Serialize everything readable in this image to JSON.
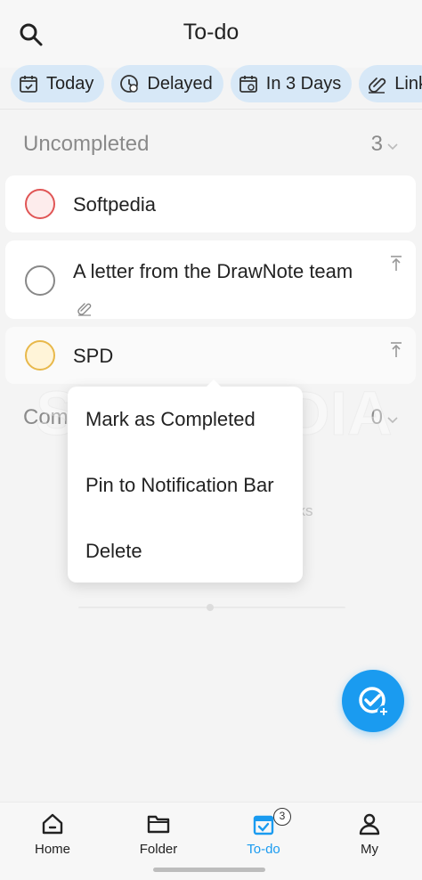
{
  "header": {
    "title": "To-do"
  },
  "chips": [
    {
      "label": "Today",
      "icon": "calendar-check-icon"
    },
    {
      "label": "Delayed",
      "icon": "clock-alert-icon"
    },
    {
      "label": "In 3 Days",
      "icon": "calendar-icon"
    },
    {
      "label": "Link",
      "icon": "link-icon"
    }
  ],
  "uncompleted": {
    "label": "Uncompleted",
    "count": "3"
  },
  "tasks": [
    {
      "title": "Softpedia",
      "circle_color": "#e05555",
      "circle_fill": "#fdecec"
    },
    {
      "title": "A letter from the DrawNote team",
      "circle_color": "#8a8a8a",
      "circle_fill": "#ffffff"
    },
    {
      "title": "SPD",
      "circle_color": "#e8b84a",
      "circle_fill": "#fff4d8"
    }
  ],
  "completed": {
    "label_partial": "Com",
    "count": "0"
  },
  "empty_hint_fragment": "sks",
  "watermark": "SOFTPEDIA",
  "context_menu": {
    "items": [
      "Mark as Completed",
      "Pin to Notification Bar",
      "Delete"
    ]
  },
  "bottom_nav": {
    "items": [
      {
        "label": "Home",
        "icon": "home-icon",
        "active": false
      },
      {
        "label": "Folder",
        "icon": "folder-icon",
        "active": false
      },
      {
        "label": "To-do",
        "icon": "todo-calendar-icon",
        "active": true,
        "badge": "3"
      },
      {
        "label": "My",
        "icon": "person-icon",
        "active": false
      }
    ]
  },
  "colors": {
    "accent": "#1a9bf0",
    "chip_bg": "#d7e8f7"
  }
}
